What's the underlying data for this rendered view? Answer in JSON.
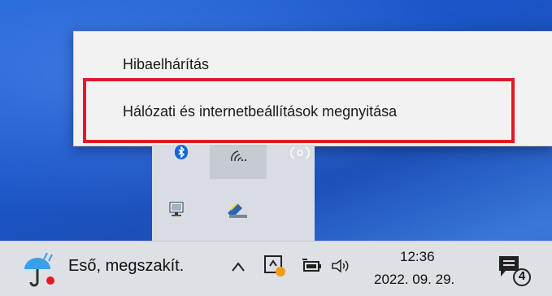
{
  "context_menu": {
    "items": [
      {
        "label": "Hibaelhárítás"
      },
      {
        "label": "Hálózati és internetbeállítások megnyitása"
      }
    ]
  },
  "tray_flyout": {
    "icons": [
      "bluetooth-icon",
      "wifi-icon",
      "sync-icon",
      "network-computer-icon",
      "scanner-icon"
    ]
  },
  "taskbar": {
    "weather": {
      "icon": "rain-umbrella-icon",
      "text": "Eső, megszakít."
    },
    "tray_icons": [
      "chevron-up-icon",
      "app-tray-icon",
      "battery-icon",
      "speaker-icon"
    ],
    "clock": {
      "time": "12:36",
      "date": "2022. 09. 29."
    },
    "notifications": {
      "icon": "action-center-icon",
      "count": "4"
    }
  },
  "colors": {
    "highlight": "#e01b24",
    "taskbar": "#dde0e5",
    "menu": "#f2f2f2",
    "wallpaper": "#1f63d6"
  }
}
